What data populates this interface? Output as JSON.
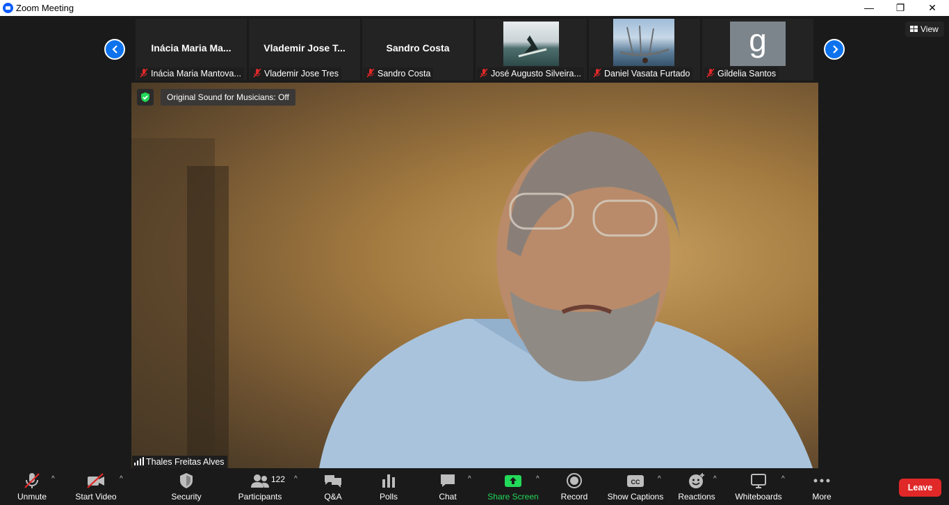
{
  "window": {
    "title": "Zoom Meeting",
    "minimize": "—",
    "maximize": "❐",
    "close": "✕"
  },
  "view_button": {
    "label": "View"
  },
  "gallery": [
    {
      "big_name": "Inácia  Maria  Ma...",
      "caption": "Inácia Maria Mantova..."
    },
    {
      "big_name": "Vlademir Jose T...",
      "caption": "Vlademir Jose Tres"
    },
    {
      "big_name": "Sandro Costa",
      "caption": "Sandro Costa"
    },
    {
      "caption": "José Augusto Silveira..."
    },
    {
      "caption": "Daniel Vasata Furtado"
    },
    {
      "avatar_letter": "g",
      "caption": "Gildelia Santos"
    }
  ],
  "banner": {
    "sound_text": "Original Sound for Musicians: Off"
  },
  "active_speaker": {
    "name": "Thales Freitas Alves"
  },
  "toolbar": {
    "unmute": "Unmute",
    "start_video": "Start Video",
    "security": "Security",
    "participants": "Participants",
    "participants_count": "122",
    "qa": "Q&A",
    "polls": "Polls",
    "chat": "Chat",
    "share_screen": "Share Screen",
    "record": "Record",
    "show_captions": "Show Captions",
    "reactions": "Reactions",
    "whiteboards": "Whiteboards",
    "more": "More",
    "leave": "Leave"
  },
  "colors": {
    "accent": "#0e72ed",
    "share_green": "#23d959",
    "leave_red": "#e02828",
    "mic_muted_red": "#e02828"
  }
}
